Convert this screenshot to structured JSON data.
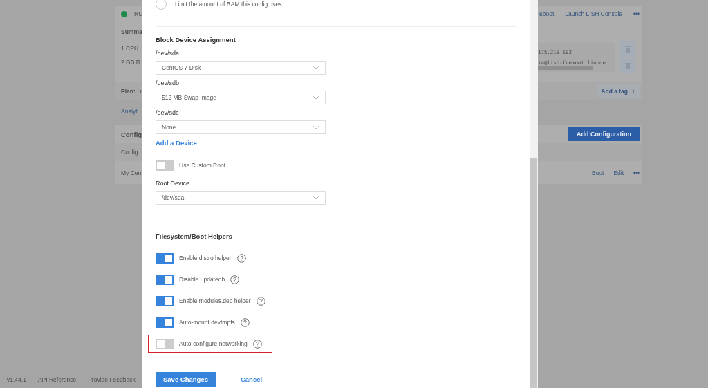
{
  "background": {
    "status": {
      "text": "RU",
      "color": "#1f8a4c"
    },
    "actions": [
      "eboot",
      "Launch LISH Console",
      "•••"
    ],
    "summary_title": "Summa",
    "summary_lines": [
      "1 CPU",
      "2 GB R"
    ],
    "access_lines": [
      "175.218.192",
      "ia@lish-fremont.linode."
    ],
    "plan": "**Plan:** Li",
    "tag_button": {
      "label": "Add a tag",
      "icon": "+"
    },
    "analytics_tab": "Analyti",
    "config_title": "Config",
    "add_config_button": "Add Configuration",
    "config_column": "Config",
    "config_row": {
      "name": "My Cen",
      "actions": [
        "Boot",
        "Edit",
        "•••"
      ]
    }
  },
  "dialog": {
    "memory_limit": {
      "label": "Limit the amount of RAM this config uses",
      "selected": false
    },
    "block_devices": {
      "title": "Block Device Assignment",
      "devices": [
        {
          "label": "/dev/sda",
          "value": "CentOS 7 Disk"
        },
        {
          "label": "/dev/sdb",
          "value": "512 MB Swap Image"
        },
        {
          "label": "/dev/sdc",
          "value": "None"
        }
      ],
      "add_device": "Add a Device",
      "custom_root": {
        "label": "Use Custom Root",
        "on": false
      },
      "root_device": {
        "label": "Root Device",
        "value": "/dev/sda"
      }
    },
    "helpers": {
      "title": "Filesystem/Boot Helpers",
      "items": [
        {
          "label": "Enable distro helper",
          "on": true,
          "highlighted": false
        },
        {
          "label": "Disable updatedb",
          "on": true,
          "highlighted": false
        },
        {
          "label": "Enable modules.dep helper",
          "on": true,
          "highlighted": false
        },
        {
          "label": "Auto-mount devtmpfs",
          "on": true,
          "highlighted": false
        },
        {
          "label": "Auto-configure networking",
          "on": false,
          "highlighted": true
        }
      ]
    },
    "save_button": "Save Changes",
    "cancel_button": "Cancel"
  },
  "footer": [
    "v1.44.1",
    "API Reference",
    "Provide Feedback"
  ]
}
